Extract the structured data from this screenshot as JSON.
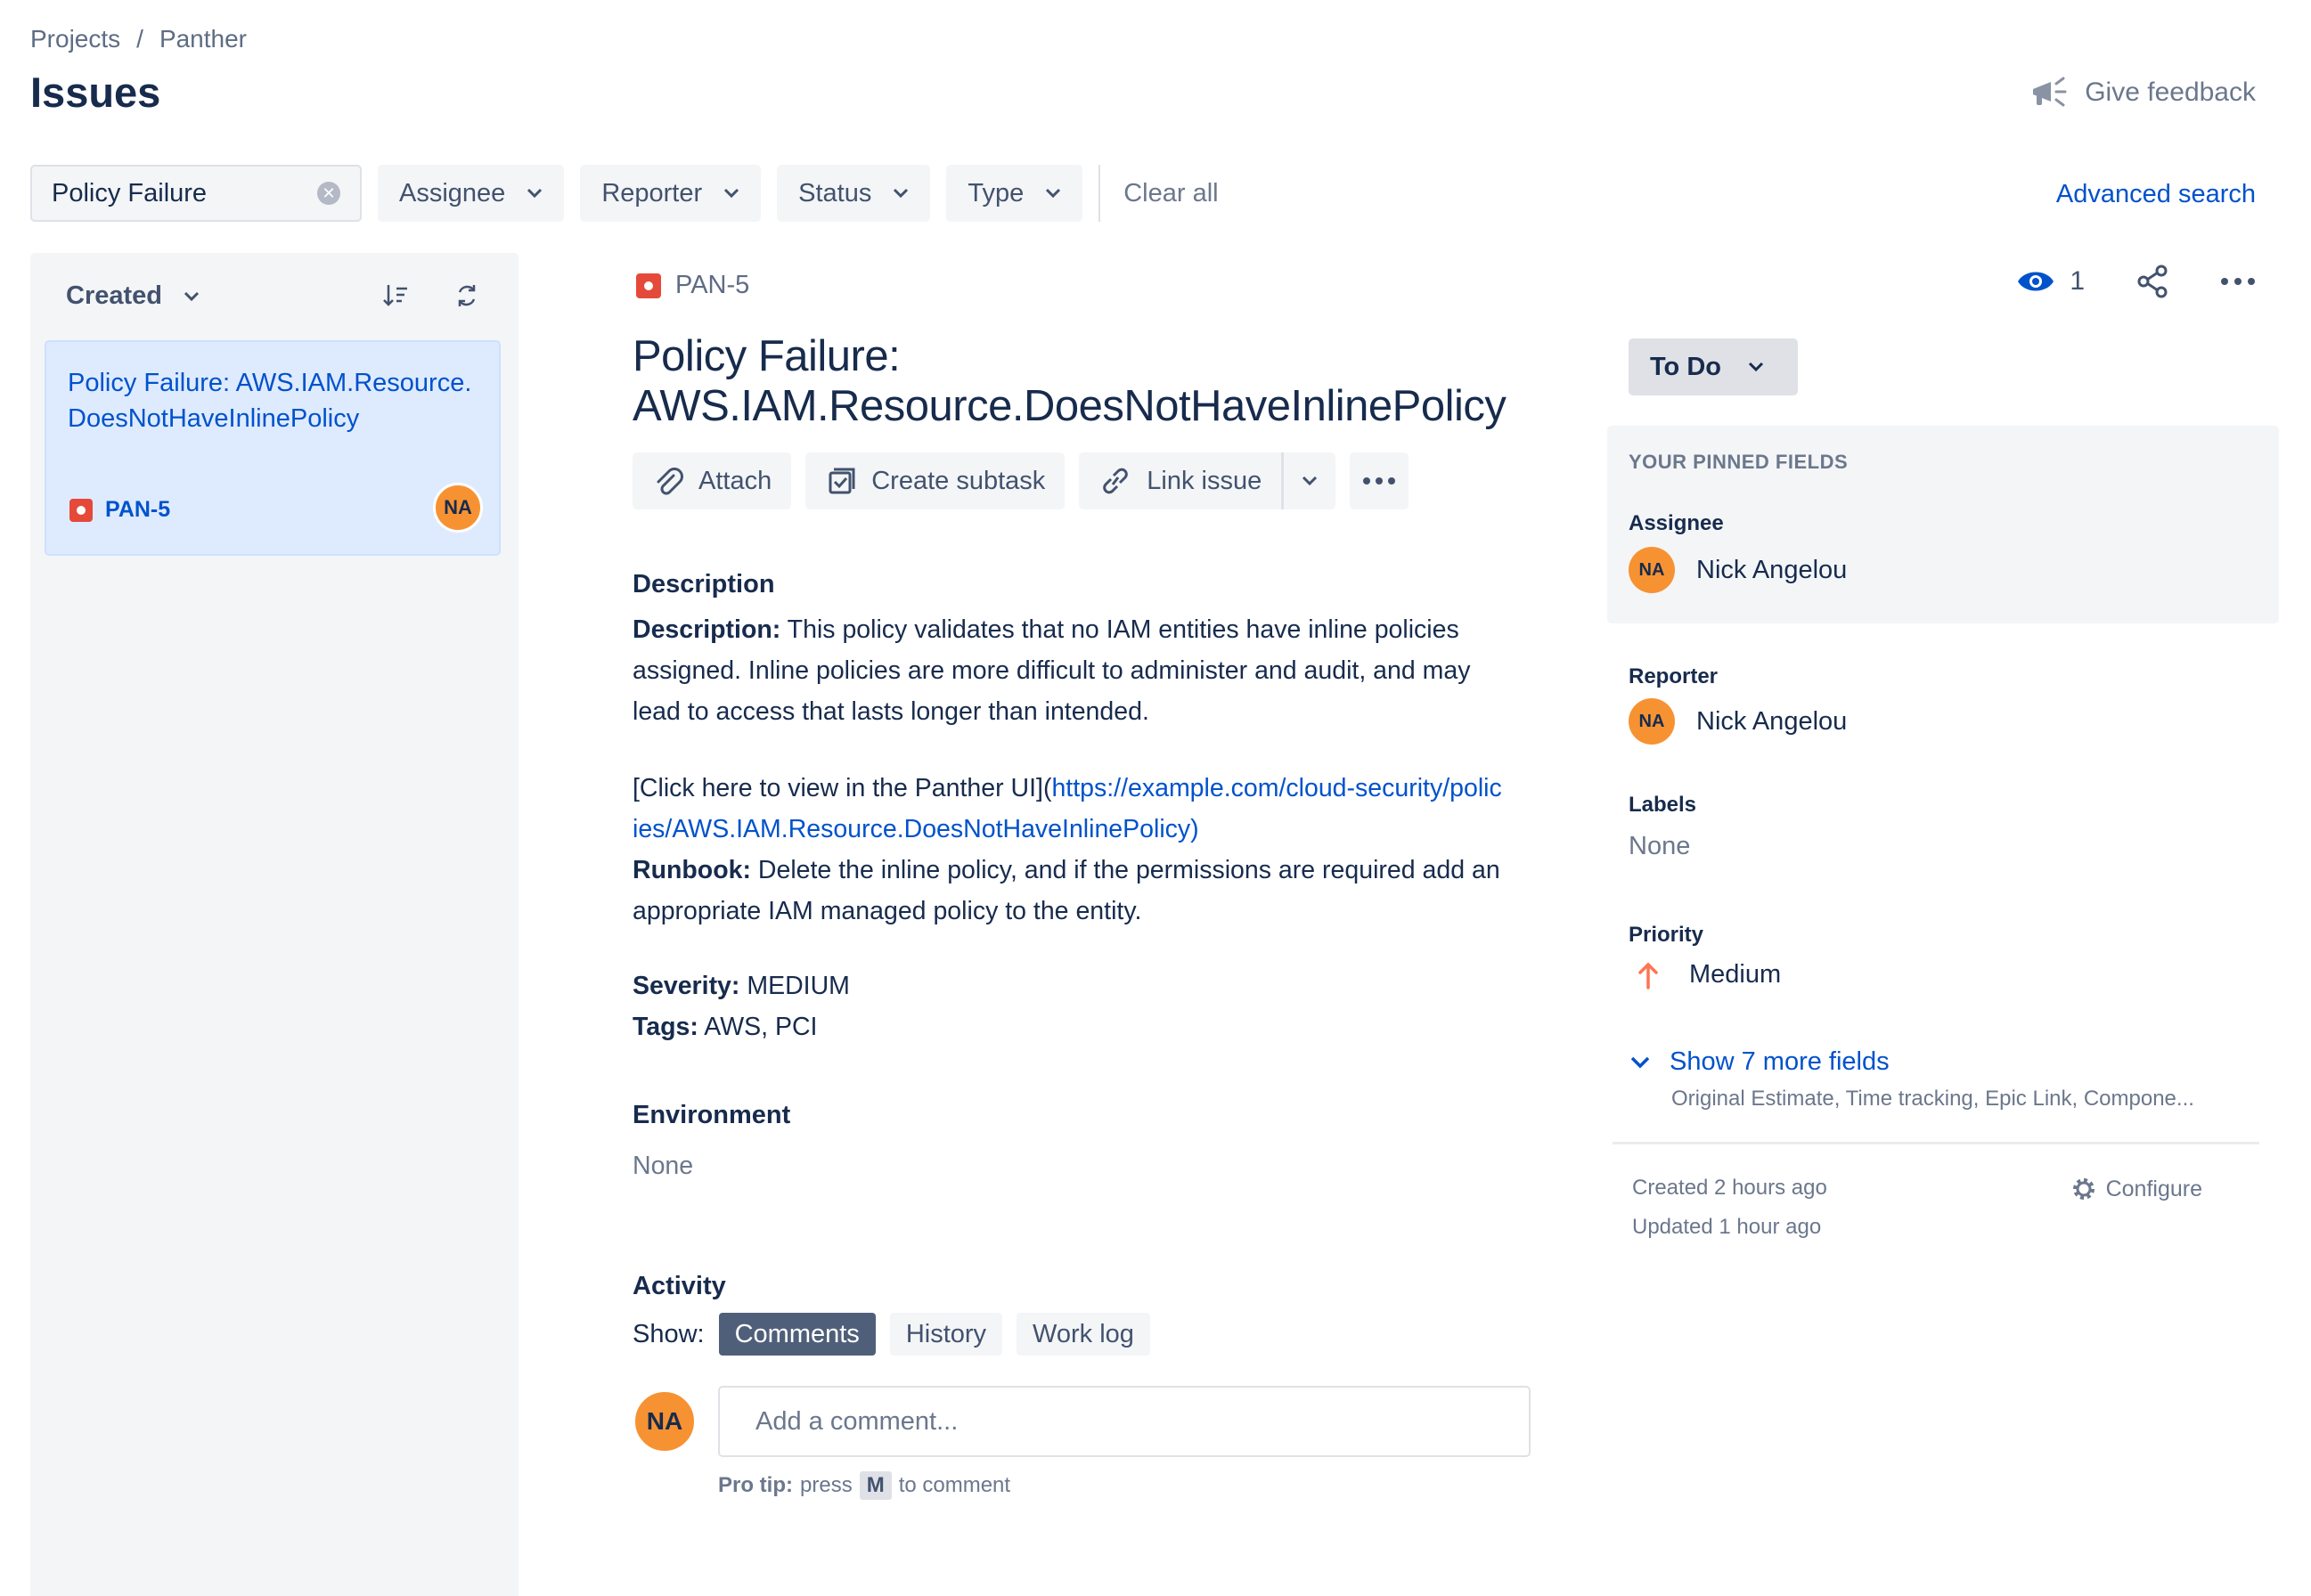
{
  "breadcrumb": {
    "projects": "Projects",
    "separator": "/",
    "project": "Panther"
  },
  "page_title": "Issues",
  "feedback_label": "Give feedback",
  "filters": {
    "search_value": "Policy Failure",
    "assignee": "Assignee",
    "reporter": "Reporter",
    "status": "Status",
    "type": "Type",
    "clear_all": "Clear all",
    "advanced_search": "Advanced search"
  },
  "list": {
    "sort_label": "Created",
    "items": [
      {
        "title": "Policy Failure: AWS.IAM.Resource.DoesNotHaveInlinePolicy",
        "key": "PAN-5",
        "avatar": "NA"
      }
    ]
  },
  "issue": {
    "key": "PAN-5",
    "title": "Policy Failure: AWS.IAM.Resource.DoesNotHaveInlinePolicy",
    "actions": {
      "attach": "Attach",
      "create_subtask": "Create subtask",
      "link_issue": "Link issue"
    },
    "description_heading": "Description",
    "description": {
      "label": "Description:",
      "text": " This policy validates that no IAM entities have inline policies assigned. Inline policies are more difficult to administer and audit, and may lead to access that lasts longer than intended.",
      "link_prefix": "[Click here to view in the Panther UI](",
      "link_url": "https://example.com/cloud-security/policies/AWS.IAM.Resource.DoesNotHaveInlinePolicy)",
      "runbook_label": "Runbook:",
      "runbook_text": " Delete the inline policy, and if the permissions are required add an appropriate IAM managed policy to the entity.",
      "severity_label": "Severity:",
      "severity_value": " MEDIUM",
      "tags_label": "Tags:",
      "tags_value": " AWS, PCI"
    },
    "environment_heading": "Environment",
    "environment_value": "None",
    "activity": {
      "heading": "Activity",
      "show_label": "Show:",
      "tabs": [
        "Comments",
        "History",
        "Work log"
      ],
      "active_tab": "Comments",
      "comment_avatar": "NA",
      "comment_placeholder": "Add a comment...",
      "pro_tip_label": "Pro tip:",
      "pro_tip_press": "press",
      "pro_tip_key": "M",
      "pro_tip_suffix": "to comment"
    }
  },
  "sidebar": {
    "watchers_count": "1",
    "status": "To Do",
    "pinned_heading": "YOUR PINNED FIELDS",
    "assignee_label": "Assignee",
    "assignee_avatar": "NA",
    "assignee_name": "Nick Angelou",
    "reporter_label": "Reporter",
    "reporter_avatar": "NA",
    "reporter_name": "Nick Angelou",
    "labels_label": "Labels",
    "labels_value": "None",
    "priority_label": "Priority",
    "priority_value": "Medium",
    "show_more": "Show 7 more fields",
    "more_fields_list": "Original Estimate, Time tracking, Epic Link, Compone...",
    "created": "Created 2 hours ago",
    "updated": "Updated 1 hour ago",
    "configure": "Configure"
  },
  "colors": {
    "link": "#0052cc",
    "bug": "#e5493a",
    "avatar": "#f79232",
    "priority_medium": "#ff7452",
    "active_tab": "#505f79"
  }
}
